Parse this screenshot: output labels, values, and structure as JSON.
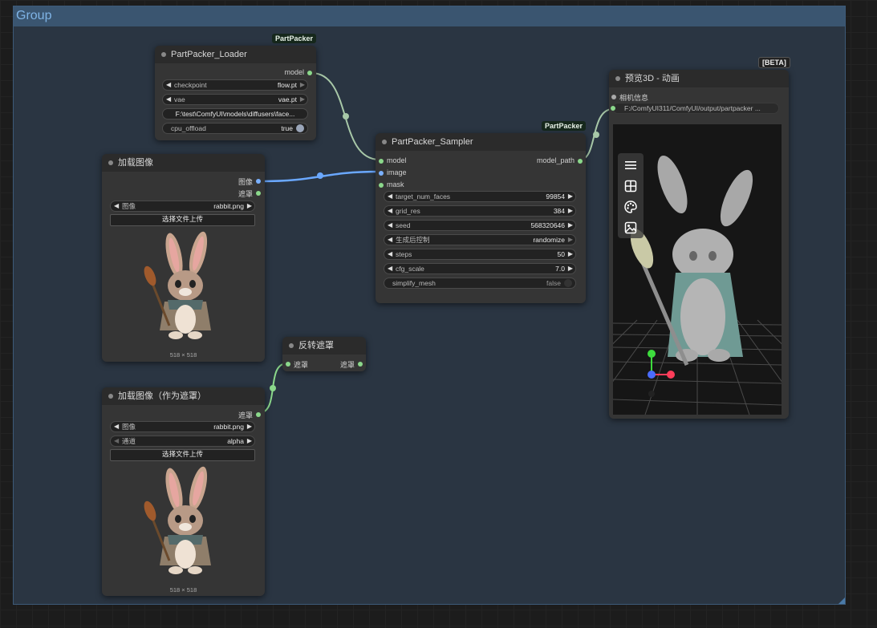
{
  "group": {
    "title": "Group"
  },
  "loader": {
    "badge": "PartPacker",
    "title": "PartPacker_Loader",
    "output_model": "model",
    "checkpoint": {
      "label": "checkpoint",
      "value": "flow.pt"
    },
    "vae": {
      "label": "vae",
      "value": "vae.pt"
    },
    "path": "F:\\test\\ComfyUI\\models\\diffusers\\face...",
    "cpu_offload": {
      "label": "cpu_offload",
      "value": "true"
    }
  },
  "load_image": {
    "title": "加载图像",
    "output_image": "图像",
    "output_mask": "遮罩",
    "image": {
      "label": "图像",
      "value": "rabbit.png"
    },
    "upload_label": "选择文件上传",
    "size": "518 × 518"
  },
  "load_image_mask": {
    "title": "加载图像（作为遮罩）",
    "output_mask": "遮罩",
    "image": {
      "label": "图像",
      "value": "rabbit.png"
    },
    "channel": {
      "label": "通道",
      "value": "alpha"
    },
    "upload_label": "选择文件上传",
    "size": "518 × 518"
  },
  "invert_mask": {
    "title": "反转遮罩",
    "input": "遮罩",
    "output": "遮罩"
  },
  "sampler": {
    "badge": "PartPacker",
    "title": "PartPacker_Sampler",
    "inputs": [
      "model",
      "image",
      "mask"
    ],
    "output": "model_path",
    "widgets": [
      {
        "label": "target_num_faces",
        "value": "99854"
      },
      {
        "label": "grid_res",
        "value": "384"
      },
      {
        "label": "seed",
        "value": "568320646"
      },
      {
        "label": "生成后控制",
        "value": "randomize"
      },
      {
        "label": "steps",
        "value": "50"
      },
      {
        "label": "cfg_scale",
        "value": "7.0"
      }
    ],
    "simplify": {
      "label": "simplify_mesh",
      "value": "false"
    }
  },
  "preview3d": {
    "badge": "[BETA]",
    "title": "预览3D - 动画",
    "input_camera": "相机信息",
    "path": "F:/ComfyUI311/ComfyUI/output/partpacker ...",
    "toolbar_icons": [
      "menu-icon",
      "grid-icon",
      "palette-icon",
      "image-icon"
    ]
  },
  "colors": {
    "group_bg": "#2a3542",
    "group_header": "#3a5570",
    "model_wire": "#a8c8a8",
    "image_wire": "#6aa8ff",
    "mask_wire": "#8bd88b"
  }
}
